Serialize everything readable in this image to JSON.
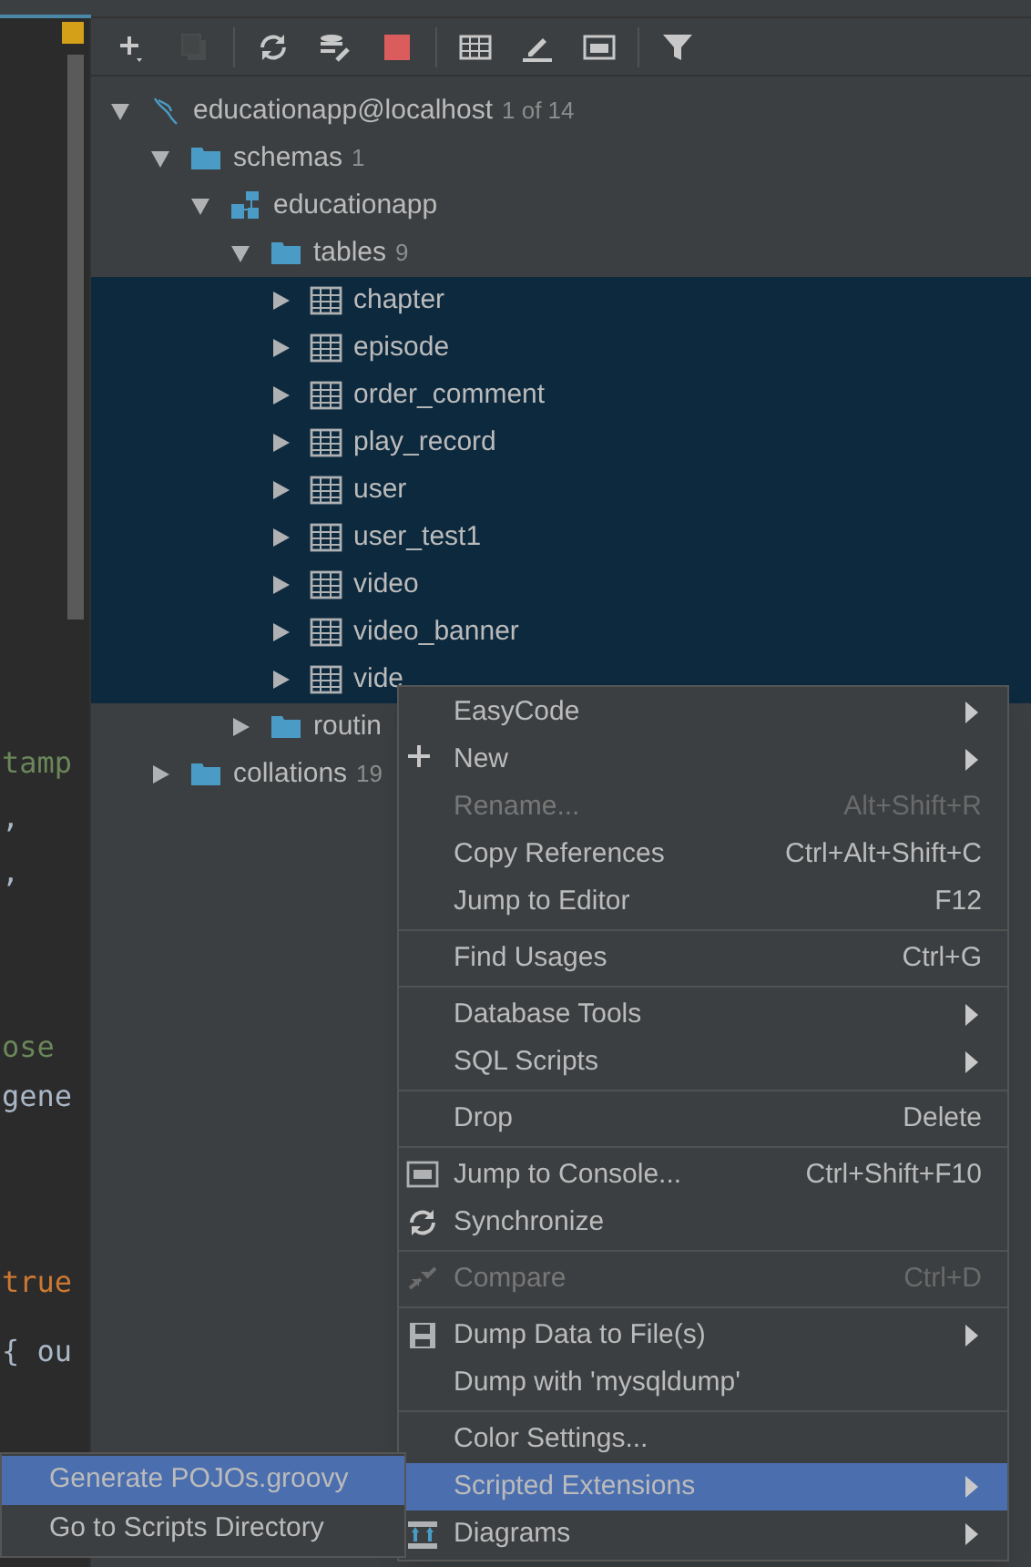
{
  "editor": {
    "lines": [
      {
        "text": "tamp",
        "kind": "string"
      },
      {
        "text": ",",
        "kind": "plain"
      },
      {
        "text": ",",
        "kind": "plain"
      },
      {
        "text": "ose",
        "kind": "string"
      },
      {
        "text": "gene",
        "kind": "plain"
      },
      {
        "text": "true",
        "kind": "keyword"
      },
      {
        "text": "{ ou",
        "kind": "plain"
      }
    ]
  },
  "toolbar": [
    {
      "kind": "add",
      "disabled": false
    },
    {
      "kind": "duplicate",
      "disabled": true
    },
    {
      "kind": "separator"
    },
    {
      "kind": "refresh",
      "disabled": false
    },
    {
      "kind": "tools",
      "disabled": false
    },
    {
      "kind": "stop",
      "disabled": false
    },
    {
      "kind": "separator"
    },
    {
      "kind": "table",
      "disabled": false
    },
    {
      "kind": "edit",
      "disabled": false
    },
    {
      "kind": "console",
      "disabled": false
    },
    {
      "kind": "separator"
    },
    {
      "kind": "filter",
      "disabled": false
    }
  ],
  "tree": [
    {
      "kind": "connection",
      "label": "educationapp@localhost",
      "count": "1 of 14",
      "expanded": true,
      "selected": false,
      "children": [
        {
          "kind": "folder",
          "label": "schemas",
          "count": "1",
          "expanded": true,
          "selected": false,
          "children": [
            {
              "kind": "schema",
              "label": "educationapp",
              "expanded": true,
              "selected": false,
              "children": [
                {
                  "kind": "folder",
                  "label": "tables",
                  "count": "9",
                  "expanded": true,
                  "selected": false,
                  "children": [
                    {
                      "kind": "table",
                      "label": "chapter",
                      "expanded": false,
                      "selected": true
                    },
                    {
                      "kind": "table",
                      "label": "episode",
                      "expanded": false,
                      "selected": true
                    },
                    {
                      "kind": "table",
                      "label": "order_comment",
                      "expanded": false,
                      "selected": true
                    },
                    {
                      "kind": "table",
                      "label": "play_record",
                      "expanded": false,
                      "selected": true
                    },
                    {
                      "kind": "table",
                      "label": "user",
                      "expanded": false,
                      "selected": true
                    },
                    {
                      "kind": "table",
                      "label": "user_test1",
                      "expanded": false,
                      "selected": true
                    },
                    {
                      "kind": "table",
                      "label": "video",
                      "expanded": false,
                      "selected": true
                    },
                    {
                      "kind": "table",
                      "label": "video_banner",
                      "expanded": false,
                      "selected": true
                    },
                    {
                      "kind": "table",
                      "label": "vide",
                      "expanded": false,
                      "selected": true
                    }
                  ]
                },
                {
                  "kind": "folder",
                  "label": "routin",
                  "expanded": false,
                  "selected": false
                }
              ]
            }
          ]
        },
        {
          "kind": "folder",
          "label": "collations",
          "count": "19",
          "expanded": false,
          "selected": false
        }
      ]
    }
  ],
  "context_menu": [
    {
      "kind": "item",
      "label": "EasyCode",
      "submenu": true,
      "disabled": false,
      "selected": false
    },
    {
      "kind": "item",
      "label": "New",
      "submenu": true,
      "disabled": false,
      "selected": false
    },
    {
      "kind": "item",
      "label": "Rename...",
      "shortcut": "Alt+Shift+R",
      "submenu": false,
      "disabled": true,
      "selected": false
    },
    {
      "kind": "item",
      "label": "Copy References",
      "shortcut": "Ctrl+Alt+Shift+C",
      "submenu": false,
      "disabled": false,
      "selected": false
    },
    {
      "kind": "item",
      "label": "Jump to Editor",
      "shortcut": "F12",
      "submenu": false,
      "disabled": false,
      "selected": false
    },
    {
      "kind": "separator"
    },
    {
      "kind": "item",
      "label": "Find Usages",
      "shortcut": "Ctrl+G",
      "submenu": false,
      "disabled": false,
      "selected": false
    },
    {
      "kind": "separator"
    },
    {
      "kind": "item",
      "label": "Database Tools",
      "submenu": true,
      "disabled": false,
      "selected": false
    },
    {
      "kind": "item",
      "label": "SQL Scripts",
      "submenu": true,
      "disabled": false,
      "selected": false
    },
    {
      "kind": "separator"
    },
    {
      "kind": "item",
      "label": "Drop",
      "shortcut": "Delete",
      "submenu": false,
      "disabled": false,
      "selected": false
    },
    {
      "kind": "separator"
    },
    {
      "kind": "item",
      "label": "Jump to Console...",
      "shortcut": "Ctrl+Shift+F10",
      "submenu": false,
      "disabled": false,
      "selected": false
    },
    {
      "kind": "item",
      "label": "Synchronize",
      "submenu": false,
      "disabled": false,
      "selected": false
    },
    {
      "kind": "separator"
    },
    {
      "kind": "item",
      "label": "Compare",
      "shortcut": "Ctrl+D",
      "submenu": false,
      "disabled": true,
      "selected": false
    },
    {
      "kind": "separator"
    },
    {
      "kind": "item",
      "label": "Dump Data to File(s)",
      "submenu": true,
      "disabled": false,
      "selected": false
    },
    {
      "kind": "item",
      "label": "Dump with 'mysqldump'",
      "submenu": false,
      "disabled": false,
      "selected": false
    },
    {
      "kind": "separator"
    },
    {
      "kind": "item",
      "label": "Color Settings...",
      "submenu": false,
      "disabled": false,
      "selected": false
    },
    {
      "kind": "item",
      "label": "Scripted Extensions",
      "submenu": true,
      "disabled": false,
      "selected": true
    },
    {
      "kind": "item",
      "label": "Diagrams",
      "submenu": true,
      "disabled": false,
      "selected": false
    }
  ],
  "submenu": [
    {
      "label": "Generate POJOs.groovy",
      "selected": true
    },
    {
      "label": "Go to Scripts Directory",
      "selected": false
    }
  ]
}
